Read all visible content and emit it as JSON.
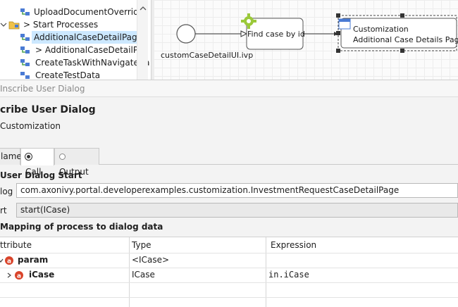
{
  "tree": {
    "items": [
      {
        "label": "UploadDocumentOverride",
        "level": 3
      },
      {
        "label": "> Start Processes",
        "level": 2
      },
      {
        "label": "AdditionalCaseDetailPage",
        "level": 3,
        "selected": true
      },
      {
        "label": "> AdditionalCaseDetailPag",
        "level": 3
      },
      {
        "label": "CreateTaskWithNavigateBa",
        "level": 3
      },
      {
        "label": "CreateTestData",
        "level": 3
      }
    ]
  },
  "canvas": {
    "start_label": "customCaseDetailUI.ivp",
    "task_label": "Find case by id",
    "sub_title": "Customization",
    "sub_name": "Additional Case Details Page"
  },
  "view": {
    "title": "Inscribe User Dialog",
    "dialog_title": "cribe User Dialog",
    "subtitle": "Customization",
    "tabs": [
      {
        "label": "Name",
        "display": "lame"
      },
      {
        "label": "Call",
        "display": "Call",
        "active": true
      },
      {
        "label": "Output",
        "display": "Output"
      }
    ],
    "section_start": "User Dialog Start",
    "dialog_label": "log",
    "dialog_value": "com.axonivy.portal.developerexamples.customization.InvestmentRequestCaseDetailPage",
    "start_label": "rt",
    "start_value": "start(ICase)",
    "section_mapping": "Mapping of process to dialog data",
    "table": {
      "headers": [
        "ttribute",
        "Type",
        "Expression"
      ],
      "rows": [
        {
          "attribute": "param",
          "type": "<ICase>",
          "expression": ""
        },
        {
          "attribute": "iCase",
          "type": "ICase",
          "expression": "in.iCase"
        }
      ]
    }
  },
  "colors": {
    "accent": "#cce8ff",
    "error": "#d9442b",
    "gear": "#9bc93a"
  }
}
